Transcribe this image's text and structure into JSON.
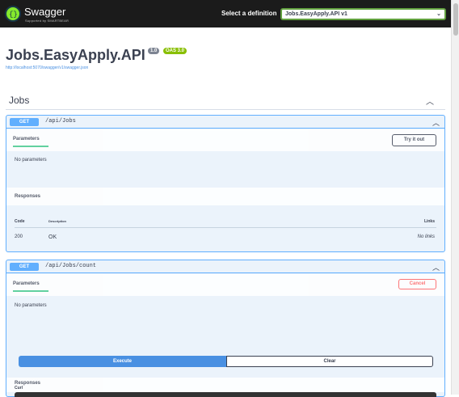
{
  "topbar": {
    "logo_text": "Swagger",
    "logo_sub": "Supported by SMARTBEAR",
    "definition_label": "Select a definition",
    "definition_value": "Jobs.EasyApply.API v1"
  },
  "info": {
    "title": "Jobs.EasyApply.API",
    "version": "1.0",
    "oas": "OAS 3.0",
    "url": "http://localhost:5070/swagger/v1/swagger.json"
  },
  "section": {
    "title": "Jobs"
  },
  "operations": [
    {
      "method": "GET",
      "path": "/api/Jobs",
      "tab_label": "Parameters",
      "action_label": "Try it out",
      "no_params": "No parameters",
      "responses_title": "Responses",
      "headers": {
        "code": "Code",
        "description": "Description",
        "links": "Links"
      },
      "rows": [
        {
          "code": "200",
          "description": "OK",
          "links": "No links"
        }
      ]
    },
    {
      "method": "GET",
      "path": "/api/Jobs/count",
      "tab_label": "Parameters",
      "action_label": "Cancel",
      "no_params": "No parameters",
      "execute_label": "Execute",
      "clear_label": "Clear",
      "responses_title": "Responses",
      "curl_label": "Curl"
    }
  ],
  "colors": {
    "get": "#61affe",
    "cancel": "#ff6060",
    "tab_underline": "#49cc90",
    "version_badge": "#7d8492",
    "oas_badge": "#89bf04"
  }
}
